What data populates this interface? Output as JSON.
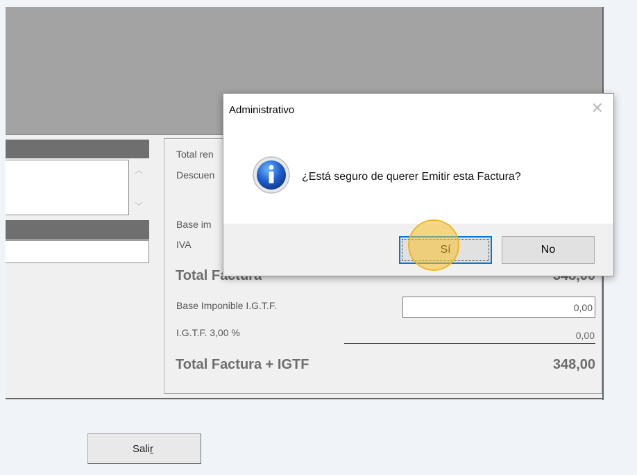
{
  "totals": {
    "total_renglones_label": "Total ren",
    "descuento_label": "Descuen",
    "base_imponible_label": "Base im",
    "iva_label": "IVA",
    "total_factura_label": "Total Factura",
    "total_factura_value": "348,00",
    "base_igtf_label": "Base Imponible I.G.T.F.",
    "base_igtf_value": "0,00",
    "igtf_label": "I.G.T.F. 3,00 %",
    "igtf_value": "0,00",
    "total_igtf_label": "Total Factura + IGTF",
    "total_igtf_value": "348,00"
  },
  "salir_button": {
    "label_pre": "Sali",
    "label_underlined": "r"
  },
  "dialog": {
    "title": "Administrativo",
    "close_glyph": "✕",
    "icon": "info-icon",
    "message": "¿Está seguro de querer Emitir esta Factura?",
    "yes_label": "Sí",
    "no_label": "No"
  },
  "colors": {
    "accent": "#0078d7",
    "highlight": "#f5c028",
    "panel_gray": "#a3a3a3"
  }
}
